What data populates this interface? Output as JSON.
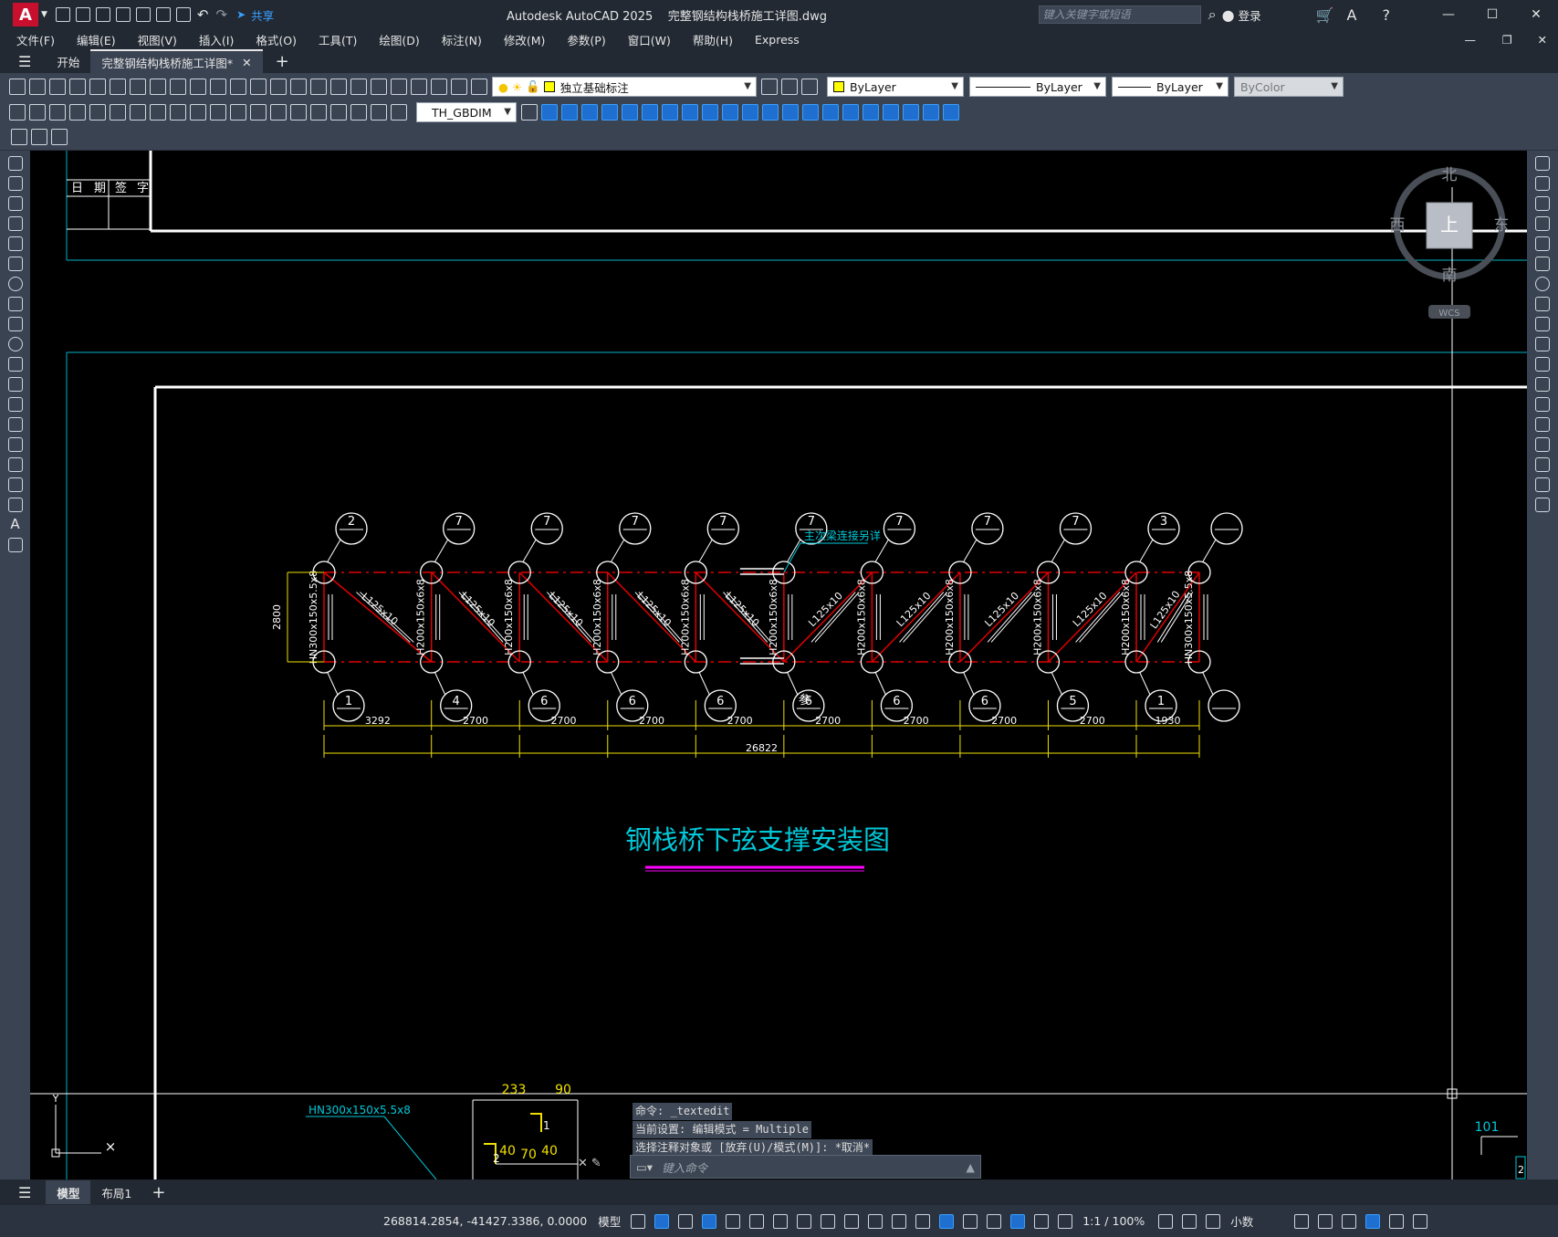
{
  "app": {
    "logo": "A",
    "title": "Autodesk AutoCAD 2025",
    "file": "完整钢结构栈桥施工详图.dwg",
    "share": "共享",
    "search_placeholder": "键入关键字或短语",
    "login": "登录"
  },
  "menu": [
    "文件(F)",
    "编辑(E)",
    "视图(V)",
    "插入(I)",
    "格式(O)",
    "工具(T)",
    "绘图(D)",
    "标注(N)",
    "修改(M)",
    "参数(P)",
    "窗口(W)",
    "帮助(H)",
    "Express"
  ],
  "tabs": {
    "start": "开始",
    "doc": "完整钢结构栈桥施工详图*"
  },
  "toolbar": {
    "layer": "独立基础标注",
    "color": "ByLayer",
    "linetype": "ByLayer",
    "lineweight": "ByLayer",
    "plotstyle": "ByColor",
    "dimstyle": "TH_GBDIM"
  },
  "viewcube": {
    "n": "北",
    "s": "南",
    "e": "东",
    "w": "西",
    "top": "上",
    "wcs": "WCS"
  },
  "drawing": {
    "title_block": [
      "日",
      "期",
      "签",
      "字"
    ],
    "main_title": "钢栈桥下弦支撑安装图",
    "annotation": "主次梁连接另详",
    "ref_note": "参",
    "height_dim": "2800",
    "top_bubbles": [
      "2",
      "7",
      "7",
      "7",
      "7",
      "7",
      "7",
      "7",
      "7",
      "3"
    ],
    "bottom_bubbles": [
      "1",
      "4",
      "6",
      "6",
      "6",
      "6",
      "6",
      "6",
      "5",
      "1"
    ],
    "spans": [
      "3292",
      "2700",
      "2700",
      "2700",
      "2700",
      "2700",
      "2700",
      "2700",
      "2700",
      "1930"
    ],
    "total": "26822",
    "end_column": "HN300x150x5.5x8",
    "column": "H200x150x6x8",
    "brace": "L125x10",
    "lower_label": "HN300x150x5.5x8",
    "lower_dims": [
      "233",
      "90",
      "40",
      "70",
      "40",
      "101"
    ],
    "lower_marks": [
      "1",
      "2",
      "2"
    ]
  },
  "command": {
    "history": [
      "命令: _textedit",
      "当前设置: 编辑模式 = Multiple",
      "选择注释对象或 [放弃(U)/模式(M)]: *取消*"
    ],
    "placeholder": "键入命令"
  },
  "layout_tabs": {
    "model": "模型",
    "layout1": "布局1"
  },
  "status": {
    "coords": "268814.2854, -41427.3386, 0.0000",
    "model": "模型",
    "scale": "1:1 / 100%",
    "units": "小数"
  }
}
